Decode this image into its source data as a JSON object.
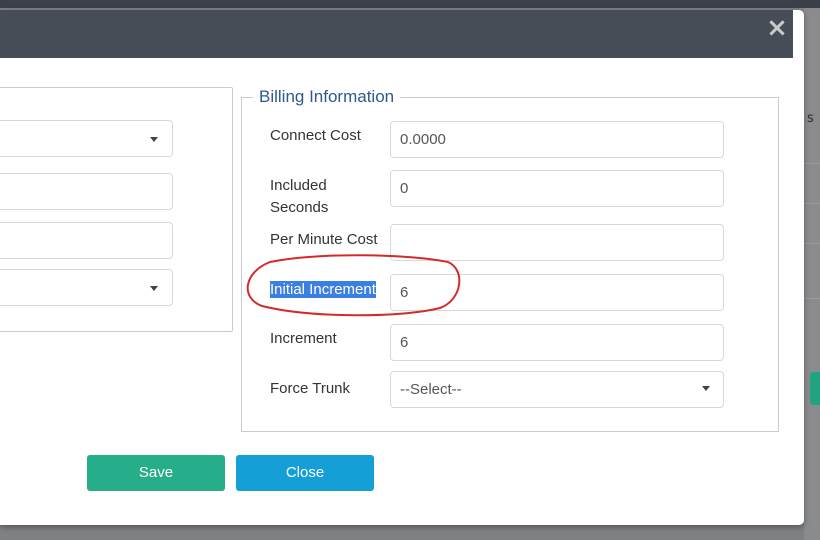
{
  "background": {
    "right_text_fragment": "s"
  },
  "modal": {
    "close_icon": "×",
    "billing": {
      "legend": "Billing Information",
      "fields": [
        {
          "label": "Connect Cost",
          "value": "0.0000"
        },
        {
          "label": "Included Seconds",
          "value": "0"
        },
        {
          "label": "Per Minute Cost",
          "value": ""
        },
        {
          "label": "Initial Increment",
          "value": "6",
          "highlighted": true
        },
        {
          "label": "Increment",
          "value": "6"
        },
        {
          "label": "Force Trunk",
          "value": "--Select--",
          "type": "select"
        }
      ]
    },
    "buttons": {
      "save": "Save",
      "close": "Close"
    },
    "colors": {
      "header": "#474d57",
      "save": "#26ad8a",
      "close": "#149fd6",
      "legend": "#2e5a8c",
      "annotation": "#d42a2a",
      "selection": "#3b7fe0"
    }
  }
}
